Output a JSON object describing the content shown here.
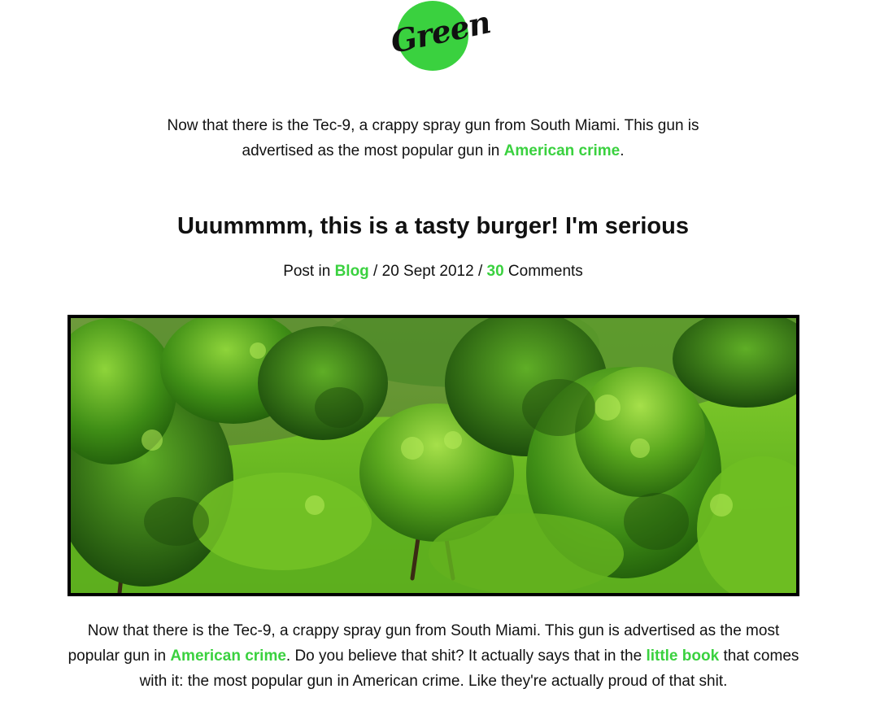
{
  "logo": {
    "text": "Green",
    "color": "#3ad13f"
  },
  "intro": {
    "text_before": "Now that there is the Tec-9, a crappy spray gun from South Miami. This gun is advertised as the most popular gun in ",
    "link": "American crime",
    "text_after": "."
  },
  "post": {
    "title": "Uuummmm, this is a tasty burger! I'm serious",
    "meta": {
      "prefix": "Post in ",
      "category": "Blog",
      "separator1": " / ",
      "date": "20 Sept 2012",
      "separator2": " / ",
      "comment_count": "30",
      "comment_label": " Comments"
    },
    "body": {
      "text1": "Now that there is the Tec-9, a crappy spray gun from South Miami. This gun is advertised as the most popular gun in ",
      "link1": "American crime",
      "text2": ". Do you believe that shit? It actually says that in the ",
      "link2": "little book",
      "text3": " that comes with it: the most popular gun in American crime. Like they're actually proud of that shit."
    }
  },
  "colors": {
    "accent": "#3ad13f",
    "text": "#111111",
    "image_border": "#000000"
  }
}
